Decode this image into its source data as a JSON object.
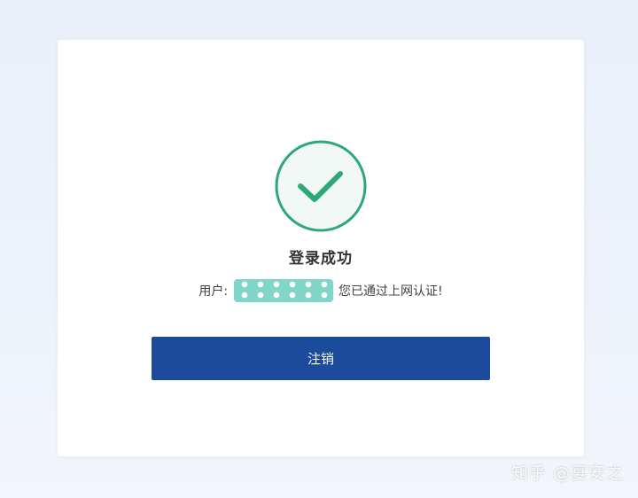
{
  "result": {
    "title": "登录成功",
    "user_label": "用户:",
    "message": "您已通过上网认证!"
  },
  "actions": {
    "logout_label": "注销"
  },
  "watermark": {
    "text": "知乎 @宴安之"
  },
  "colors": {
    "success": "#2fa877",
    "success_fill": "#f1f8f5",
    "primary_button": "#1c4b9c",
    "mask": "#7fd6c9"
  },
  "icons": {
    "status": "check-circle-icon"
  }
}
